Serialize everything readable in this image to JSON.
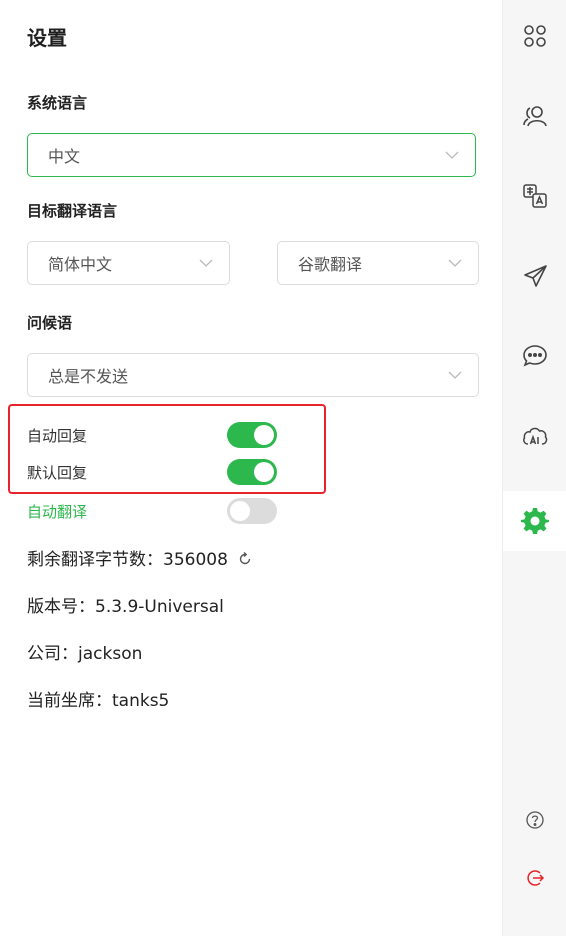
{
  "settings": {
    "title": "设置",
    "system_language": {
      "label": "系统语言",
      "value": "中文"
    },
    "target_language": {
      "label": "目标翻译语言",
      "language": "简体中文",
      "engine": "谷歌翻译"
    },
    "greeting": {
      "label": "问候语",
      "value": "总是不发送"
    },
    "toggles": [
      {
        "label": "自动回复",
        "on": true
      },
      {
        "label": "默认回复",
        "on": true
      },
      {
        "label": "自动翻译",
        "on": false
      }
    ],
    "remaining_chars": "剩余翻译字节数：356008",
    "version": "版本号：5.3.9-Universal",
    "company": "公司：jackson",
    "current_seat": "当前坐席：tanks5"
  },
  "sidebar": {
    "icons": [
      "apps-icon",
      "contacts-icon",
      "translate-icon",
      "send-icon",
      "chat-icon",
      "ai-cloud-icon",
      "settings-gear-icon",
      "help-icon",
      "logout-icon"
    ],
    "accent": "#2db84d",
    "logout_color": "#e8232b"
  }
}
